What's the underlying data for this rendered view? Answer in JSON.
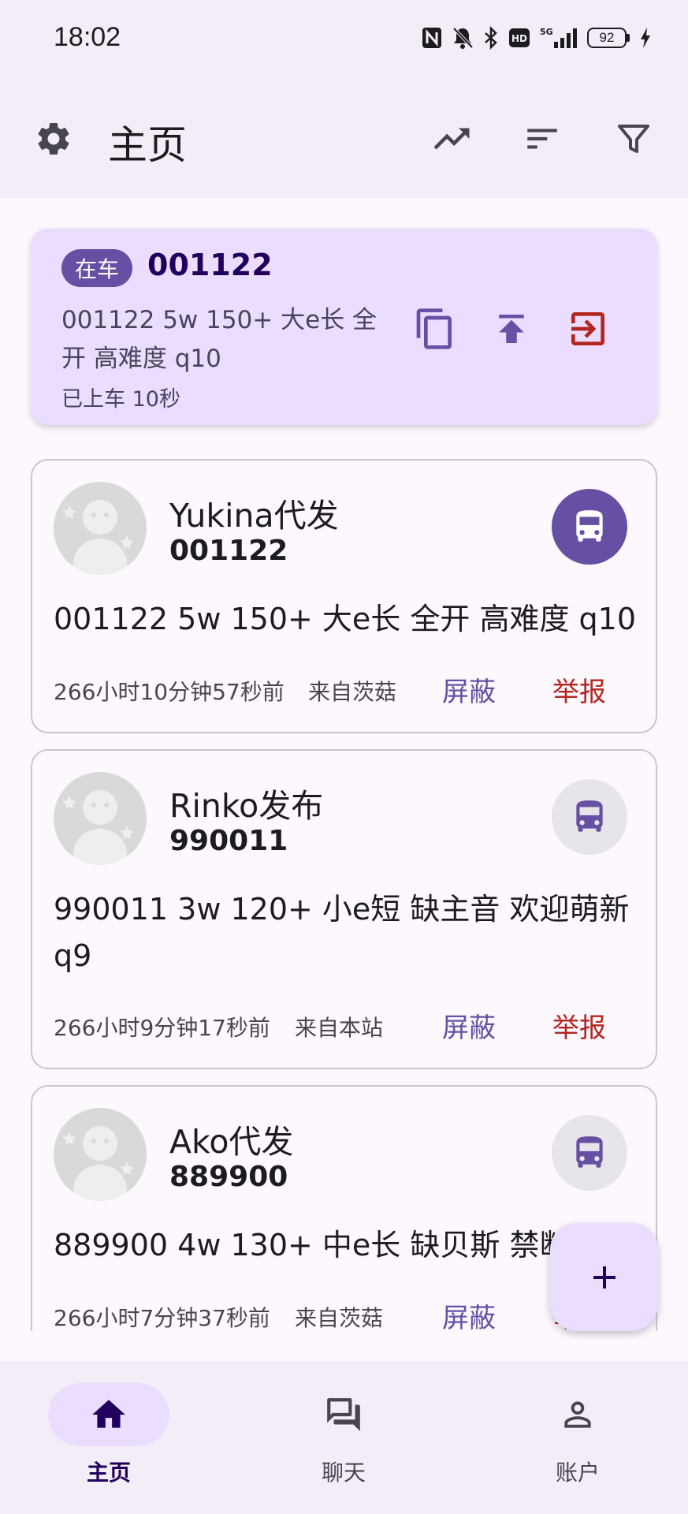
{
  "status_bar": {
    "time": "18:02",
    "battery": "92",
    "icons": [
      "nfc-icon",
      "bell-off-icon",
      "bluetooth-icon",
      "hd-icon",
      "signal-5g-icon",
      "battery-icon",
      "charging-icon"
    ]
  },
  "app_bar": {
    "title": "主页",
    "icons": [
      "gear-icon",
      "trending-icon",
      "sort-icon",
      "filter-icon"
    ]
  },
  "current_ride": {
    "chip": "在车",
    "room_id": "001122",
    "description": "001122 5w 150+ 大e长 全开 高难度 q10",
    "elapsed": "已上车 10秒",
    "actions": [
      "copy-icon",
      "publish-icon",
      "exit-icon"
    ]
  },
  "posts": [
    {
      "author": "Yukina代发",
      "room_id": "001122",
      "text": "001122 5w 150+ 大e长 全开 高难度 q10",
      "time": "266小时10分钟57秒前",
      "source": "来自茨菇",
      "block_label": "屏蔽",
      "report_label": "举报",
      "joined": true
    },
    {
      "author": "Rinko发布",
      "room_id": "990011",
      "text": "990011 3w 120+ 小e短 缺主音 欢迎萌新 q9",
      "time": "266小时9分钟17秒前",
      "source": "来自本站",
      "block_label": "屏蔽",
      "report_label": "举报",
      "joined": false
    },
    {
      "author": "Ako代发",
      "room_id": "889900",
      "text": "889900 4w 130+ 中e长 缺贝斯 禁断",
      "time": "266小时7分钟37秒前",
      "source": "来自茨菇",
      "block_label": "屏蔽",
      "report_label": "举报",
      "joined": false
    }
  ],
  "fab": {
    "icon": "plus-icon"
  },
  "bottom_nav": [
    {
      "label": "主页",
      "icon": "home-icon",
      "active": true
    },
    {
      "label": "聊天",
      "icon": "chat-icon",
      "active": false
    },
    {
      "label": "账户",
      "icon": "person-icon",
      "active": false
    }
  ],
  "colors": {
    "primary": "#6750a4",
    "primary_container": "#eaddff",
    "surface": "#fdf7fe",
    "surface_container": "#f3edf7",
    "error": "#b3261e"
  }
}
